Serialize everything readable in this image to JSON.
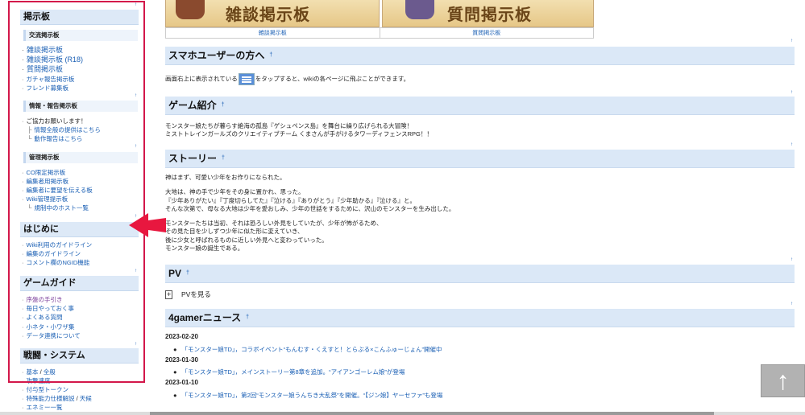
{
  "sidebar": {
    "bbs_title": "掲示板",
    "bbs_sub1": "交流掲示板",
    "bbs_items": [
      "雑談掲示板",
      "雑談掲示板 (R18)",
      "質問掲示板",
      "ガチャ報告掲示板",
      "フレンド募集板"
    ],
    "report_title": "情報・報告掲示板",
    "report_intro": "ご協力お願いします！",
    "report_items": [
      "情報全般の提供はこちら",
      "動作報告はこちら"
    ],
    "manage_title": "管理掲示板",
    "manage_items": [
      "CO限定掲示板",
      "編集者用掲示板",
      "編集者に要望を伝える板",
      "Wiki管理提示板"
    ],
    "manage_sub": "規制中のホスト一覧",
    "intro_title": "はじめに",
    "intro_items": [
      "Wiki利用のガイドライン",
      "編集のガイドライン",
      "コメント欄のNGID機能"
    ],
    "guide_title": "ゲームガイド",
    "guide_items": [
      "序盤の手引き",
      "毎日やっておく事",
      "よくある質問",
      "小ネタ・小ワザ集",
      "データ連携について"
    ],
    "battle_title": "戦闘・システム",
    "battle_item0_a": "基本",
    "battle_item0_sep": " / ",
    "battle_item0_b": "全般",
    "battle_items": [
      "攻撃速度",
      "付与型トークン"
    ],
    "battle_item3_a": "特殊能力仕様解説",
    "battle_item3_sep": " / ",
    "battle_item3_b": "天候",
    "battle_item4": "エネミー一覧",
    "up_mark": "↑"
  },
  "banners": {
    "left_text": "雑談掲示板",
    "right_text": "質問掲示板",
    "left_link": "雑談掲示板",
    "right_link": "質問掲示板"
  },
  "sections": {
    "smartphone_title": "スマホユーザーの方へ",
    "smartphone_text_a": "画面右上に表示されている",
    "smartphone_text_b": "をタップすると、wikiの各ページに飛ぶことができます。",
    "intro_title": "ゲーム紹介",
    "intro_lines": [
      "モンスター娘たちが暮らす絶海の孤島『ゲシュペンス島』を舞台に繰り広げられる大冒険！",
      "ミストトレインガールズのクリエイティブチーム くまさんが手がけるタワーディフェンスRPG！！"
    ],
    "story_title": "ストーリー",
    "story_p1": "神はまず、可愛い少年をお作りになられた。",
    "story_p2": [
      "大地は、神の手で少年をその身に置かれ、思った。",
      "『少年ありがたい』『丁度切らしてた』『泣ける』『ありがとう』『少年助かる』『泣ける』と。",
      "そんな次第で、母なる大地は少年を愛おしみ、少年の世話をするために、沢山のモンスターを生み出した。"
    ],
    "story_p3": [
      "モンスターたちは当初、それは恐ろしい外見をしていたが、少年が怖がるため、",
      "その見た目を少しずつ少年に似た形に変えていき、",
      "後に少女と呼ばれるものに近しい外見へと変わっていった。",
      "モンスター娘の誕生である。"
    ],
    "pv_title": "PV",
    "pv_toggle": "+",
    "pv_label": "PVを見る",
    "news_title": "4gamerニュース",
    "anchor": "†",
    "up_mark": "↑"
  },
  "news": [
    {
      "date": "2023-02-20",
      "text": "「モンスター娘TD」，コラボイベント“もんむす・くえすと！とらぶる×こんふゅーじょん”開催中"
    },
    {
      "date": "2023-01-30",
      "text": "「モンスター娘TD」，メインストーリー第8章を追加。“アイアンゴーレム娘”が登場"
    },
    {
      "date": "2023-01-10",
      "text": "「モンスター娘TD」，第2回“モンスター娘うんちき大乱祭”を開催。“【ジン娘】ヤーセファ”も登場"
    }
  ],
  "page_top_button": "↑",
  "colors": {
    "accent_red": "#e8173f",
    "highlight_border": "#d3174a",
    "heading_bg": "#dbe8f7",
    "link": "#1a5fb4"
  },
  "icons": [
    "hamburger-menu-icon",
    "red-arrow-icon",
    "arrow-up-icon"
  ]
}
